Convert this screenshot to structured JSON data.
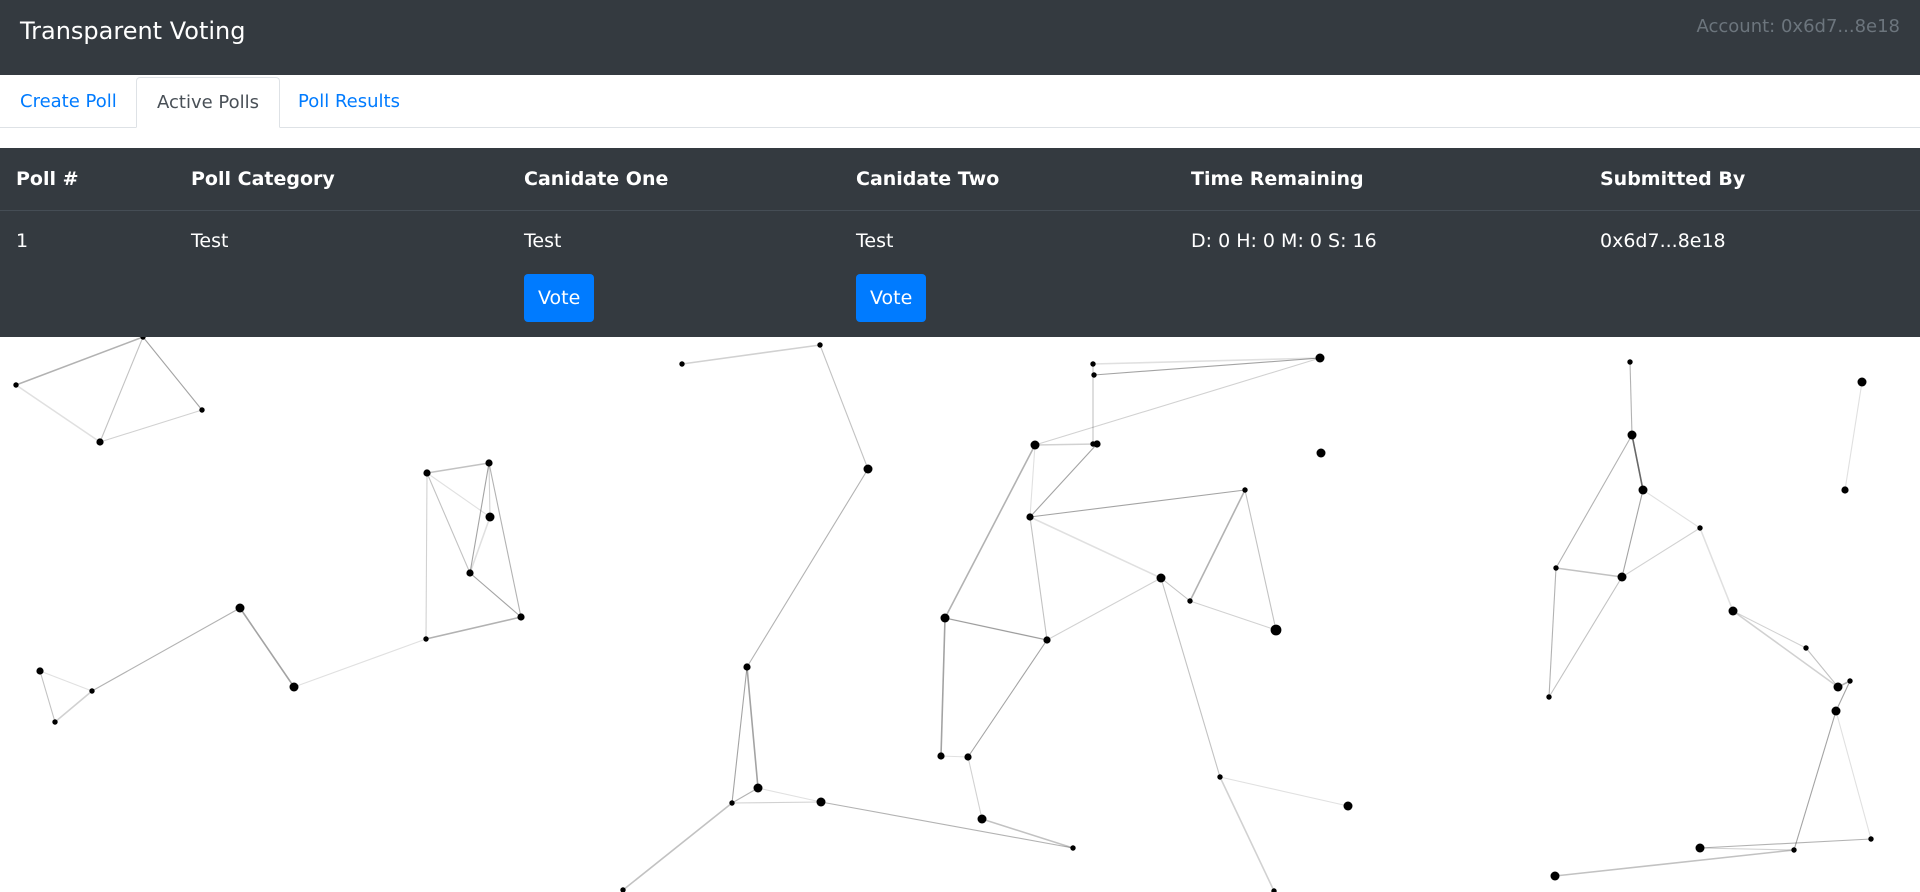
{
  "navbar": {
    "title": "Transparent Voting",
    "account": "Account: 0x6d7...8e18"
  },
  "tabs": [
    {
      "label": "Create Poll",
      "active": false
    },
    {
      "label": "Active Polls",
      "active": true
    },
    {
      "label": "Poll Results",
      "active": false
    }
  ],
  "table": {
    "headers": [
      "Poll #",
      "Poll Category",
      "Canidate One",
      "Canidate Two",
      "Time Remaining",
      "Submitted By"
    ],
    "rows": [
      {
        "poll_number": "1",
        "category": "Test",
        "candidate_one": "Test",
        "candidate_two": "Test",
        "time_remaining": "D: 0 H: 0 M: 0 S: 16",
        "submitted_by": "0x6d7...8e18",
        "vote_label": "Vote"
      }
    ]
  },
  "colors": {
    "navbar_bg": "#343a40",
    "accent": "#007bff",
    "background": "#ffffff",
    "network_nodes": "#000000"
  }
}
